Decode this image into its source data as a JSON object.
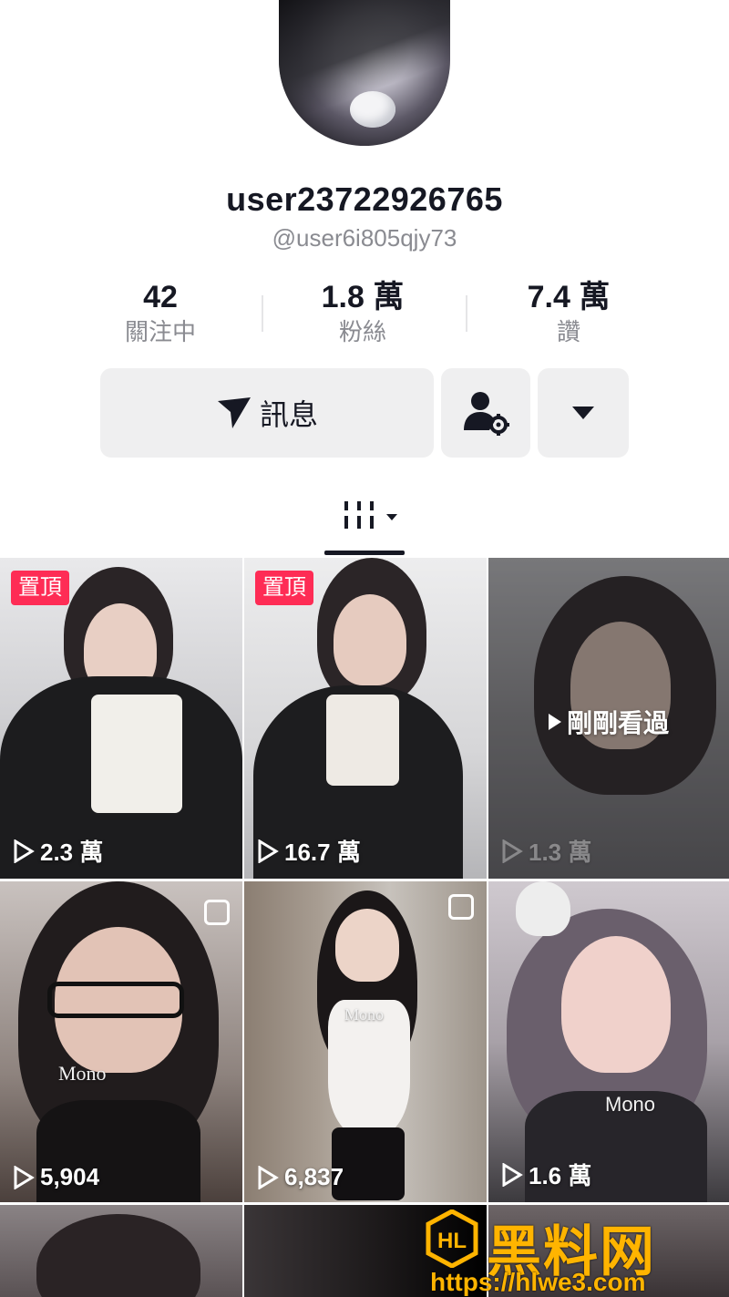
{
  "profile": {
    "username": "user23722926765",
    "handle": "@user6i805qjy73"
  },
  "stats": [
    {
      "value": "42",
      "label": "關注中"
    },
    {
      "value": "1.8 萬",
      "label": "粉絲"
    },
    {
      "value": "7.4 萬",
      "label": "讚"
    }
  ],
  "actions": {
    "message_label": "訊息",
    "friend_icon": "person-settings-icon",
    "more_icon": "caret-down-icon"
  },
  "tabs": {
    "grid_icon": "grid-filter-icon"
  },
  "videos": [
    {
      "pinned_label": "置頂",
      "views": "2.3 萬"
    },
    {
      "pinned_label": "置頂",
      "views": "16.7 萬"
    },
    {
      "viewed_label": "剛剛看過",
      "views": "1.3 萬"
    },
    {
      "overlay_text": "Mono",
      "views": "5,904"
    },
    {
      "overlay_text": "Mono",
      "views": "6,837"
    },
    {
      "overlay_text": "Mono",
      "views": "1.6 萬"
    }
  ],
  "watermark": {
    "name": "黑料网",
    "url": "https://hlwe3.com",
    "logo_text": "HL"
  },
  "colors": {
    "accent": "#fe2c55",
    "watermark": "#ffb400"
  }
}
